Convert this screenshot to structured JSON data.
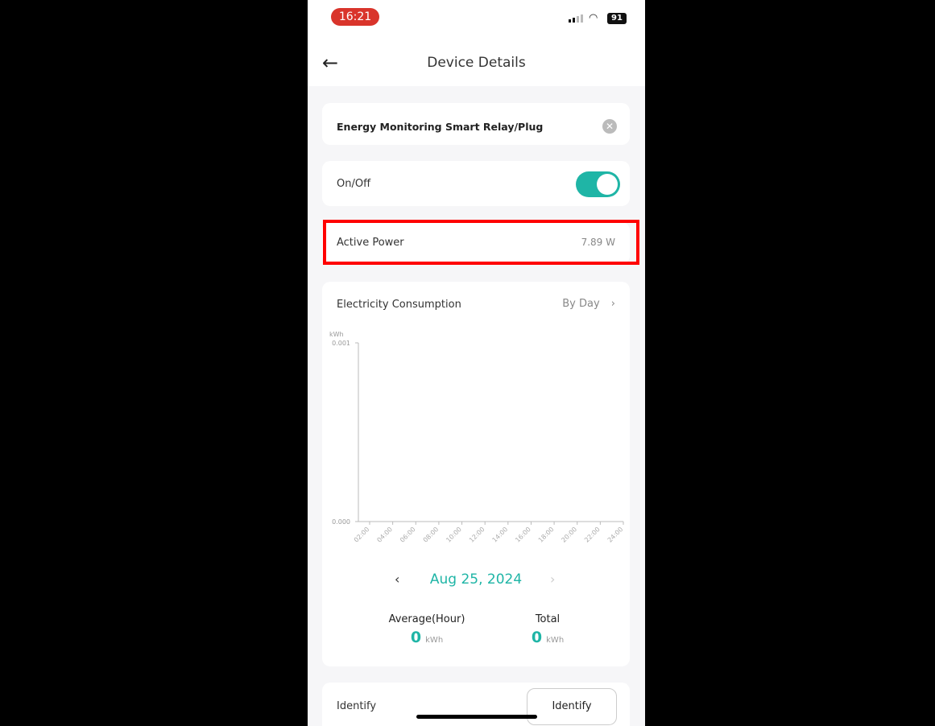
{
  "status_bar": {
    "time": "16:21",
    "battery": "91"
  },
  "header": {
    "title": "Device Details",
    "back_icon": "arrow-left-icon"
  },
  "device": {
    "name": "Energy Monitoring Smart Relay/Plug"
  },
  "onoff": {
    "label": "On/Off",
    "state": true,
    "accent": "#1fb5a6"
  },
  "active_power": {
    "label": "Active Power",
    "value": "7.89 W",
    "highlight_color": "#ff0000"
  },
  "consumption": {
    "title": "Electricity Consumption",
    "period": "By Day",
    "date": "Aug 25, 2024",
    "average_label": "Average(Hour)",
    "average_value": "0",
    "average_unit": "kWh",
    "total_label": "Total",
    "total_value": "0",
    "total_unit": "kWh"
  },
  "chart_data": {
    "type": "bar",
    "ylabel": "kWh",
    "ylim": [
      0,
      0.001
    ],
    "yticks": [
      "0.001",
      "0.000"
    ],
    "categories": [
      "02:00",
      "04:00",
      "06:00",
      "08:00",
      "10:00",
      "12:00",
      "14:00",
      "16:00",
      "18:00",
      "20:00",
      "22:00",
      "24:00"
    ],
    "values": [
      0,
      0,
      0,
      0,
      0,
      0,
      0,
      0,
      0,
      0,
      0,
      0
    ],
    "grid": false
  },
  "identify": {
    "label": "Identify",
    "button": "Identify"
  }
}
